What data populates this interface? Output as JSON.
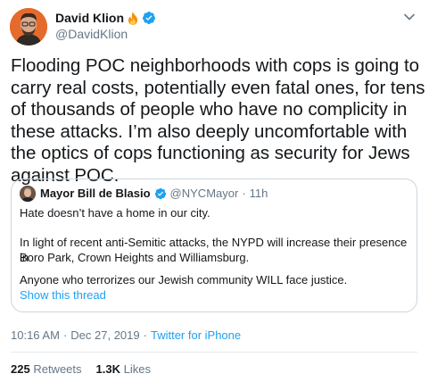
{
  "author": {
    "name": "David Klion",
    "handle": "@DavidKlion",
    "icons": [
      "fire-icon",
      "verified-icon"
    ],
    "accent": "#1da1f2"
  },
  "tweet": {
    "text": "Flooding POC neighborhoods with cops is going to carry real costs, potentially even fatal ones, for tens of thousands of people who have no complicity in these attacks. I’m also deeply uncomfortable with the optics of cops functioning as security for Jews against POC."
  },
  "quoted": {
    "name": "Mayor Bill de Blasio",
    "handle": "@NYCMayor",
    "separator": "·",
    "time": "11h",
    "line1": "Hate doesn’t have a home in our city.",
    "line2": "In light of recent anti-Semitic attacks, the NYPD will increase their presence in",
    "line3": "Boro Park, Crown Heights and Williamsburg.",
    "line4": "Anyone who terrorizes our Jewish community WILL face justice.",
    "show_thread": "Show this thread"
  },
  "meta": {
    "time": "10:16 AM",
    "separator1": "·",
    "date": "Dec 27, 2019",
    "separator2": "·",
    "source": "Twitter for iPhone"
  },
  "stats": {
    "retweets_count": "225",
    "retweets_label": "Retweets",
    "likes_count": "1.3K",
    "likes_label": "Likes"
  }
}
